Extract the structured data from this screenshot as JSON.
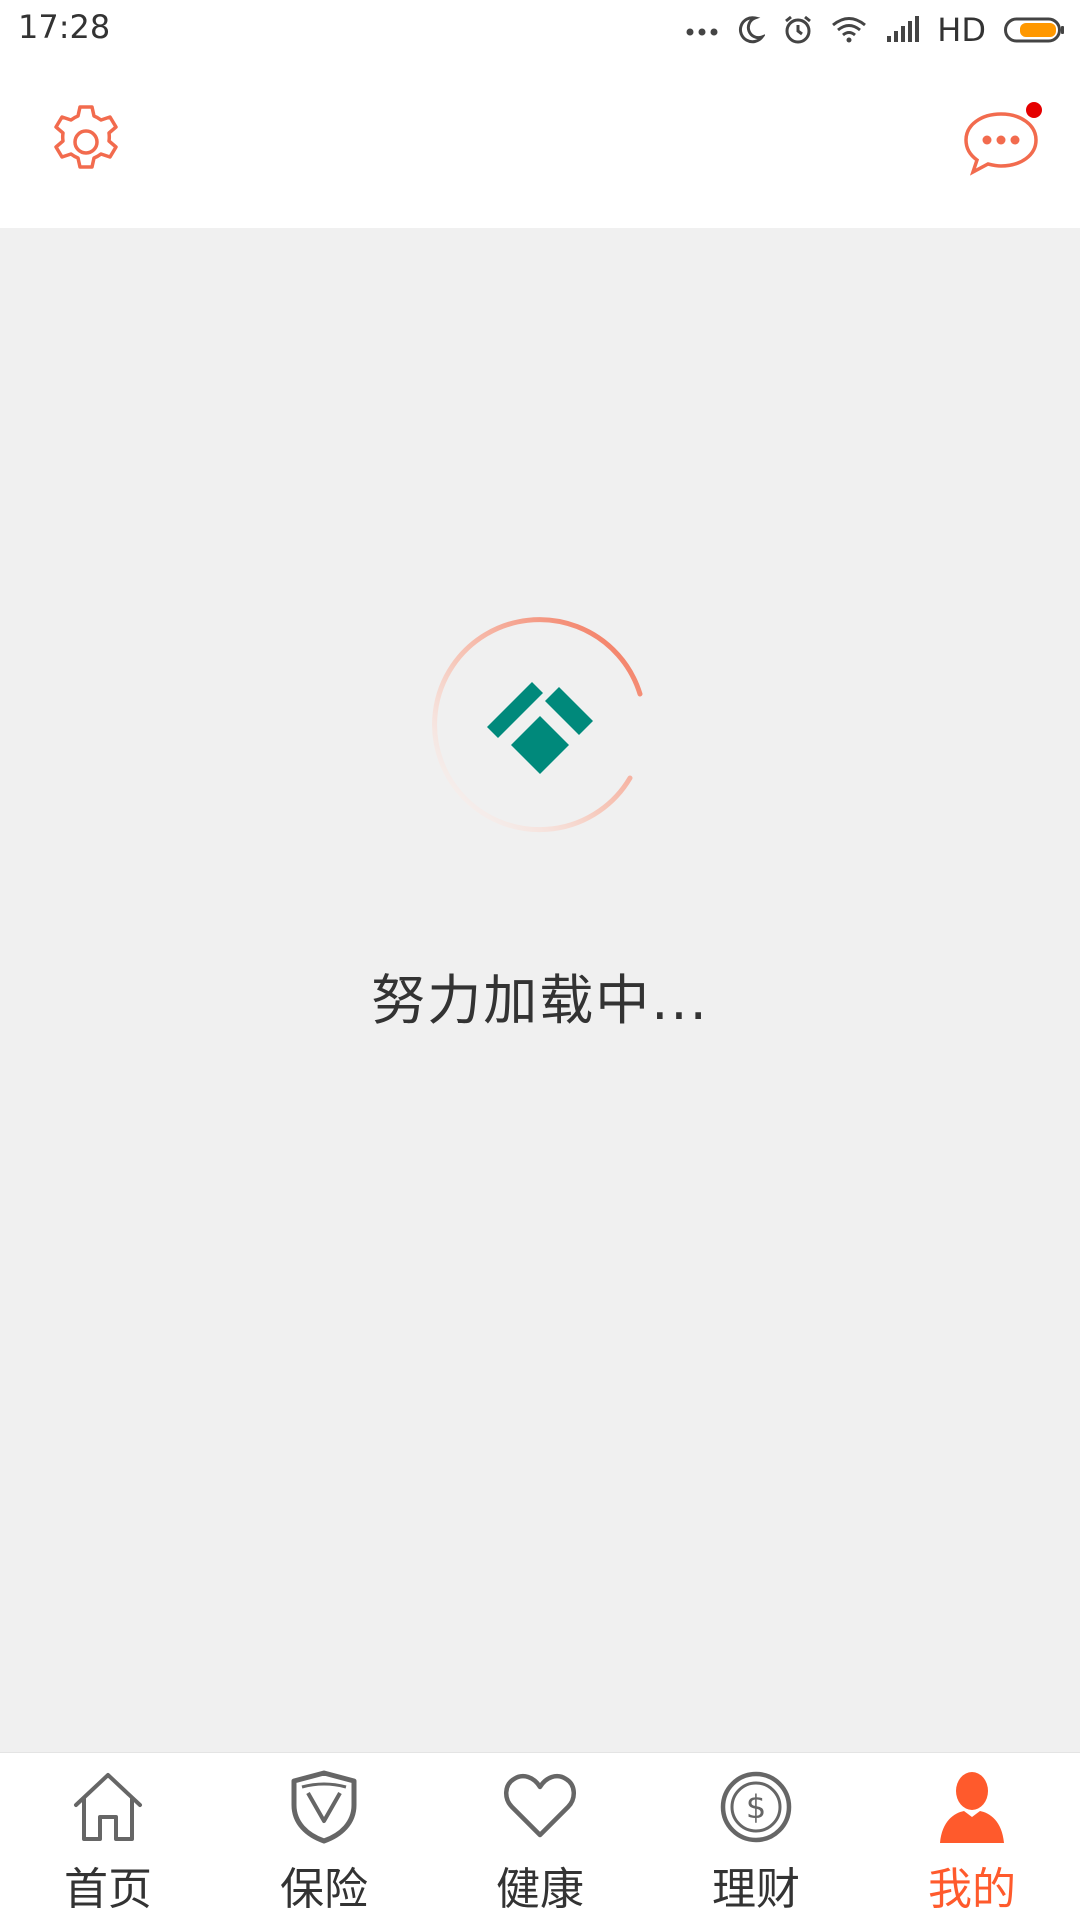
{
  "status_bar": {
    "time": "17:28",
    "network_label": "HD",
    "icons": [
      "more-dots-icon",
      "moon-icon",
      "alarm-icon",
      "wifi-icon",
      "signal-icon",
      "battery-icon"
    ]
  },
  "header": {
    "settings_icon": "gear-icon",
    "message_icon": "chat-bubble-icon",
    "has_unread": true
  },
  "loading": {
    "text": "努力加载中..."
  },
  "nav": {
    "items": [
      {
        "label": "首页",
        "icon": "home-icon",
        "active": false
      },
      {
        "label": "保险",
        "icon": "shield-icon",
        "active": false
      },
      {
        "label": "健康",
        "icon": "heart-icon",
        "active": false
      },
      {
        "label": "理财",
        "icon": "coin-icon",
        "active": false
      },
      {
        "label": "我的",
        "icon": "user-icon",
        "active": true
      }
    ]
  },
  "colors": {
    "accent": "#ff5a2c",
    "logo": "#00897b",
    "content_bg": "#f0f0f0",
    "badge": "#e50000"
  }
}
